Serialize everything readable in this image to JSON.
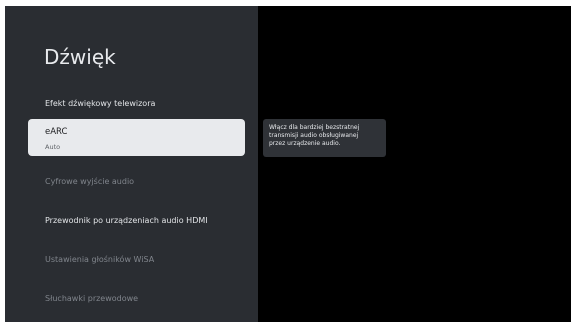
{
  "settings": {
    "title": "Dźwięk",
    "items": [
      {
        "label": "Efekt dźwiękowy telewizora"
      },
      {
        "label": "eARC",
        "value": "Auto"
      },
      {
        "label": "Cyfrowe wyjście audio"
      },
      {
        "label": "Przewodnik po urządzeniach audio HDMI"
      },
      {
        "label": "Ustawienia głośników WiSA"
      },
      {
        "label": "Słuchawki przewodowe"
      }
    ]
  },
  "description": {
    "lines": [
      "Włącz dla bardziej bezstratnej",
      "transmisji audio obsługiwanej",
      "przez urządzenie audio."
    ]
  },
  "colors": {
    "panel_background": "#2a2d32",
    "screen_background": "#000000",
    "focused_item_background": "#e8eaed",
    "tooltip_background": "#2f3237"
  }
}
